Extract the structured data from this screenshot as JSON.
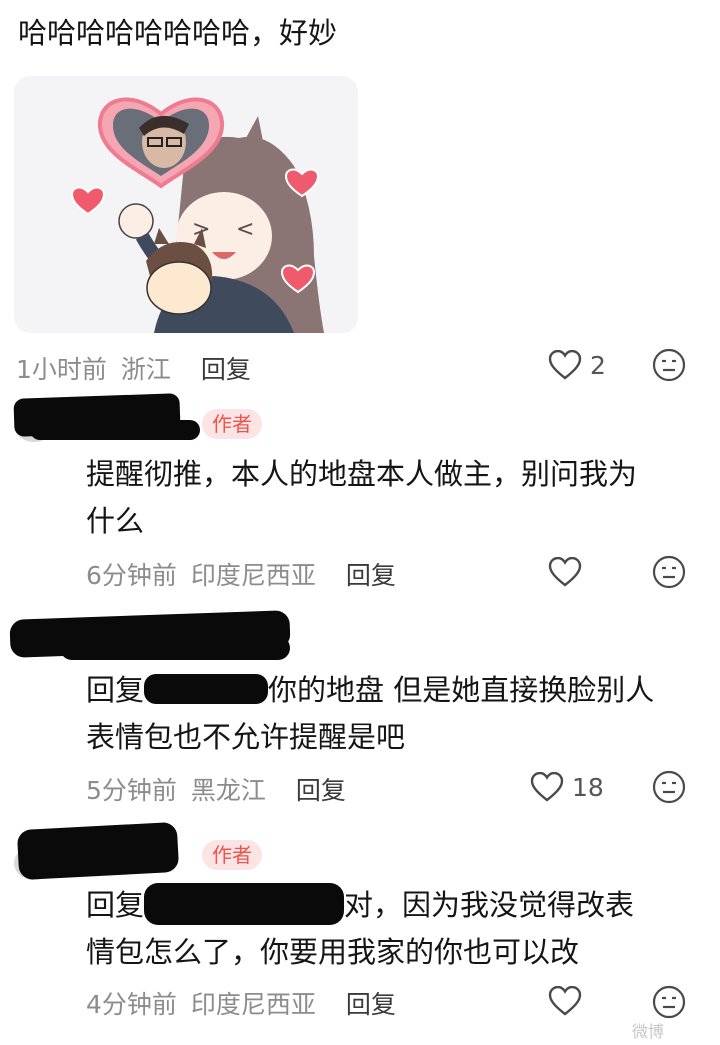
{
  "top_comment": {
    "text": "哈哈哈哈哈哈哈哈，好妙",
    "time": "1小时前",
    "location": "浙江",
    "reply_label": "回复",
    "like_count": "2"
  },
  "replies": [
    {
      "badge": "作者",
      "text_line1": "提醒彻推，本人的地盘本人做主，别问我为",
      "text_line2": "什么",
      "time": "6分钟前",
      "location": "印度尼西亚",
      "reply_label": "回复",
      "like_count": ""
    },
    {
      "text_prefix": "回复",
      "text_rest": "你的地盘 但是她直接换脸别人",
      "text_line2": "表情包也不允许提醒是吧",
      "time": "5分钟前",
      "location": "黑龙江",
      "reply_label": "回复",
      "like_count": "18"
    },
    {
      "badge": "作者",
      "text_prefix": "回复",
      "text_rest": "对，因为我没觉得改表",
      "text_line2": "情包怎么了，你要用我家的你也可以改",
      "time": "4分钟前",
      "location": "印度尼西亚",
      "reply_label": "回复",
      "like_count": ""
    }
  ],
  "watermark": "微博",
  "colors": {
    "badge_bg": "#fde4e4",
    "badge_text": "#e8574e",
    "heart": "#ef5b6d",
    "meta": "#8c8c8c"
  },
  "icons": [
    "heart-outline-icon",
    "neutral-face-icon"
  ]
}
